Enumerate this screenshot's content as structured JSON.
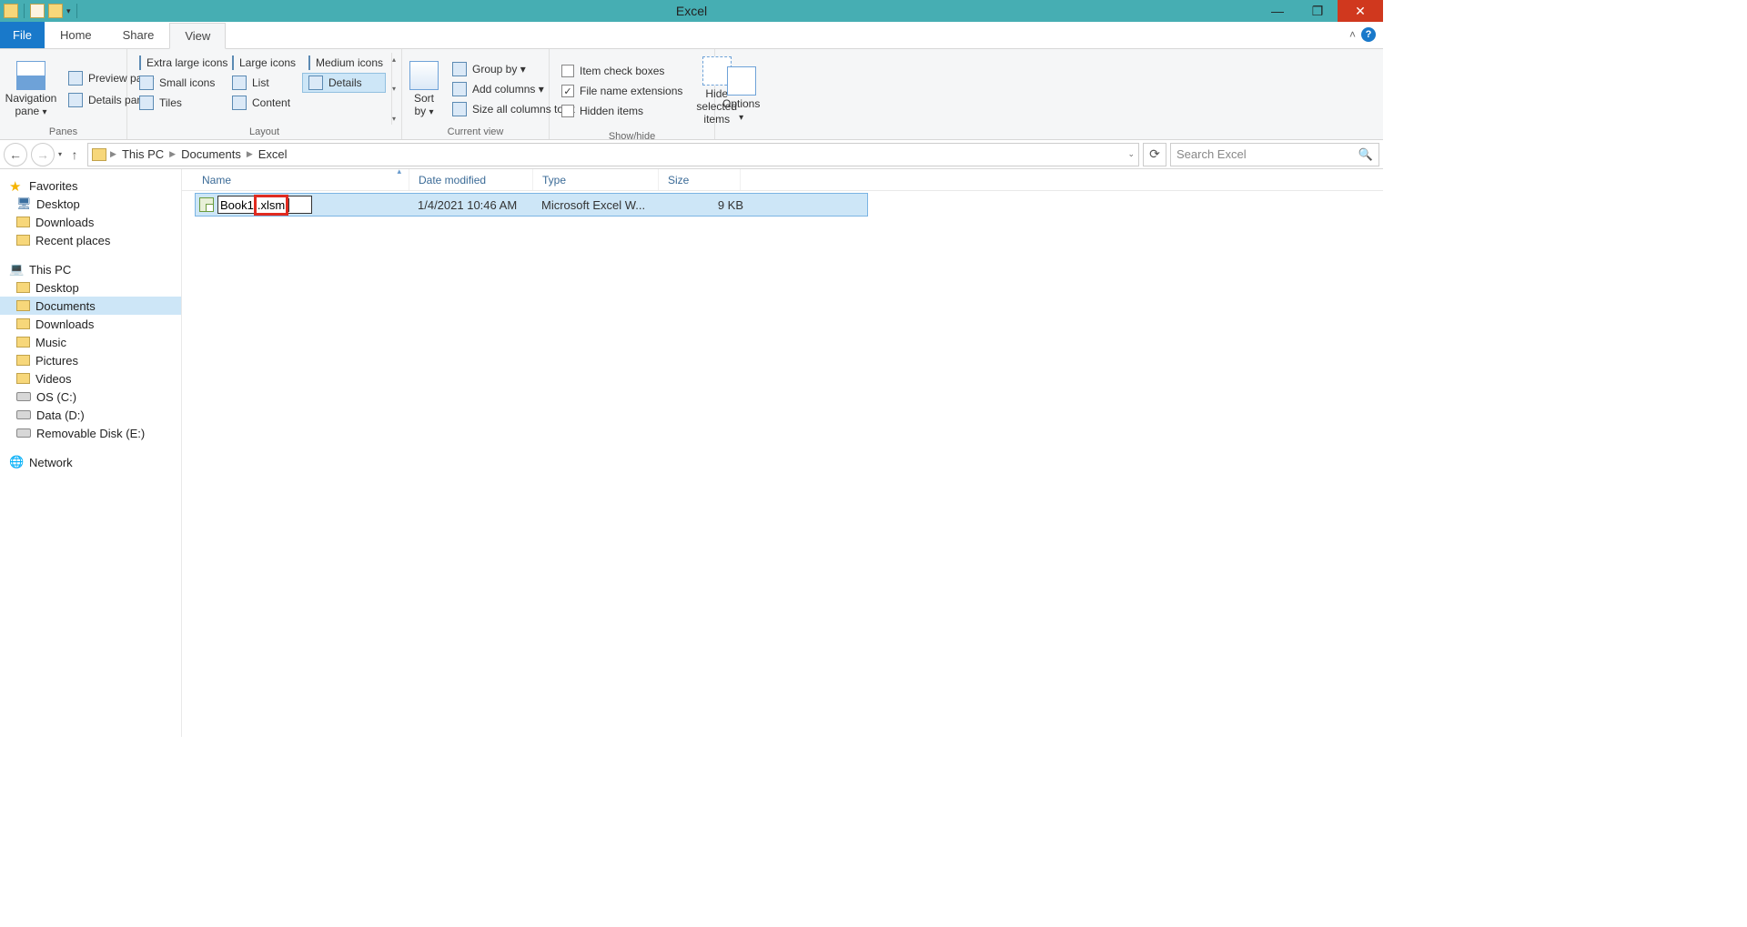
{
  "window": {
    "title": "Excel"
  },
  "tabs": {
    "file": "File",
    "home": "Home",
    "share": "Share",
    "view": "View"
  },
  "ribbon": {
    "panes": {
      "label": "Panes",
      "nav": "Navigation pane",
      "preview": "Preview pane",
      "details": "Details pane"
    },
    "layout": {
      "label": "Layout",
      "xl": "Extra large icons",
      "lg": "Large icons",
      "md": "Medium icons",
      "sm": "Small icons",
      "list": "List",
      "details": "Details",
      "tiles": "Tiles",
      "content": "Content"
    },
    "current": {
      "label": "Current view",
      "sort": "Sort by",
      "group": "Group by",
      "cols": "Add columns",
      "fit": "Size all columns to fit"
    },
    "showhide": {
      "label": "Show/hide",
      "itemchk": "Item check boxes",
      "ext": "File name extensions",
      "hidden": "Hidden items",
      "hidesel": "Hide selected items"
    },
    "options": "Options"
  },
  "breadcrumb": {
    "a": "This PC",
    "b": "Documents",
    "c": "Excel"
  },
  "search": {
    "placeholder": "Search Excel"
  },
  "navpane": {
    "fav": "Favorites",
    "fav_items": [
      "Desktop",
      "Downloads",
      "Recent places"
    ],
    "pc": "This PC",
    "pc_items": [
      "Desktop",
      "Documents",
      "Downloads",
      "Music",
      "Pictures",
      "Videos",
      "OS (C:)",
      "Data (D:)",
      "Removable Disk (E:)"
    ],
    "network": "Network"
  },
  "columns": {
    "name": "Name",
    "date": "Date modified",
    "type": "Type",
    "size": "Size"
  },
  "file": {
    "name_base": "Book1",
    "name_ext": ".xlsm",
    "date": "1/4/2021 10:46 AM",
    "type": "Microsoft Excel W...",
    "size": "9 KB"
  }
}
